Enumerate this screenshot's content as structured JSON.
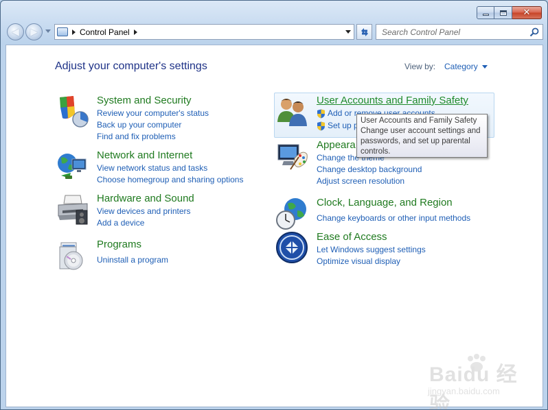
{
  "window": {
    "caption_buttons": [
      "minimize",
      "maximize",
      "close"
    ]
  },
  "navbar": {
    "breadcrumb": "Control Panel",
    "search_placeholder": "Search Control Panel"
  },
  "content": {
    "heading": "Adjust your computer's settings",
    "view_by_label": "View by:",
    "view_by_value": "Category",
    "categories_left": [
      {
        "title": "System and Security",
        "icon": "shield-flag-icon",
        "links": [
          "Review your computer's status",
          "Back up your computer",
          "Find and fix problems"
        ]
      },
      {
        "title": "Network and Internet",
        "icon": "network-globe-icon",
        "links": [
          "View network status and tasks",
          "Choose homegroup and sharing options"
        ]
      },
      {
        "title": "Hardware and Sound",
        "icon": "printer-icon",
        "links": [
          "View devices and printers",
          "Add a device"
        ]
      },
      {
        "title": "Programs",
        "icon": "programs-disc-icon",
        "links": [
          "Uninstall a program"
        ]
      }
    ],
    "categories_right": [
      {
        "title": "User Accounts and Family Safety",
        "icon": "users-icon",
        "links": [
          "Add or remove user accounts",
          "Set up p"
        ]
      },
      {
        "title": "Appeara",
        "icon": "monitor-palette-icon",
        "links": [
          "Change the theme",
          "Change desktop background",
          "Adjust screen resolution"
        ]
      },
      {
        "title": "Clock, Language, and Region",
        "icon": "clock-globe-icon",
        "links": [
          "Change keyboards or other input methods"
        ]
      },
      {
        "title": "Ease of Access",
        "icon": "ease-of-access-icon",
        "links": [
          "Let Windows suggest settings",
          "Optimize visual display"
        ]
      }
    ],
    "tooltip": {
      "title": "User Accounts and Family Safety",
      "body": "Change user account settings and passwords, and set up parental controls."
    }
  },
  "watermark": {
    "brand": "Baidu 经验",
    "url": "jingyan.baidu.com"
  },
  "colors": {
    "heading": "#1e3287",
    "category_title": "#1f7a1f",
    "link": "#1e5eb5"
  }
}
